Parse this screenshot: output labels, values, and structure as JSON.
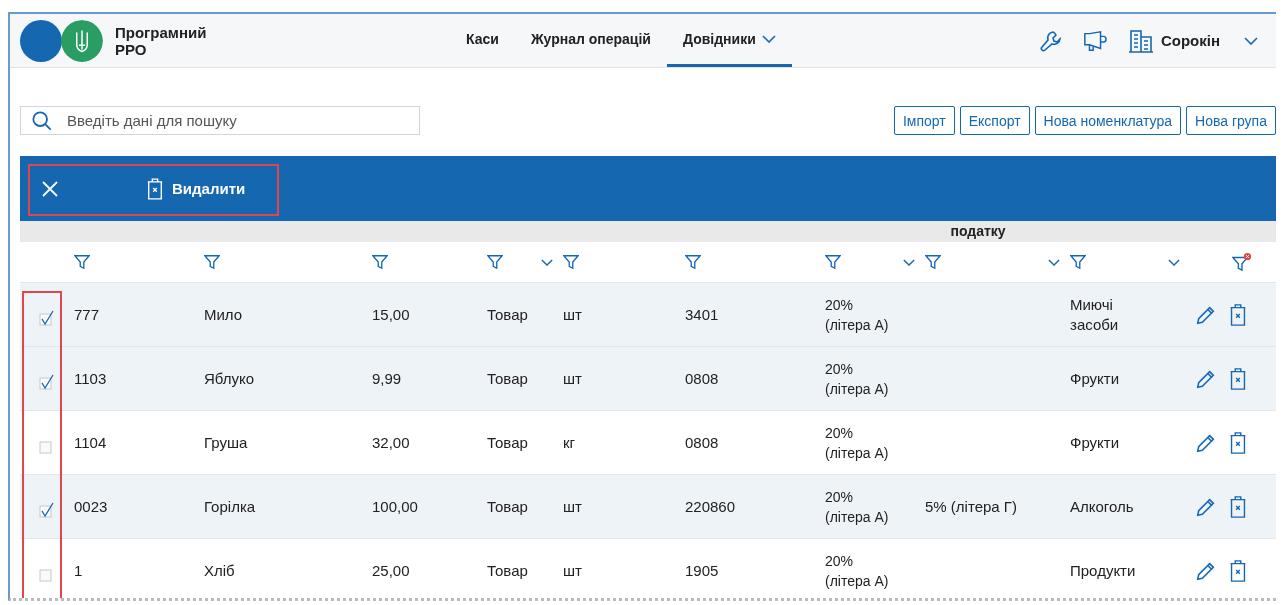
{
  "header": {
    "app_title": "Програмний РРО",
    "nav": [
      {
        "label": "Каси",
        "selected": false,
        "dropdown": false
      },
      {
        "label": "Журнал операцій",
        "selected": false,
        "dropdown": false
      },
      {
        "label": "Довідники",
        "selected": true,
        "dropdown": true
      }
    ],
    "user": "Сорокін"
  },
  "search": {
    "placeholder": "Введіть дані для пошуку"
  },
  "actions": [
    "Імпорт",
    "Експорт",
    "Нова номенклатура",
    "Нова група"
  ],
  "selection_bar": {
    "delete_label": "Видалити"
  },
  "header_fragment": "податку",
  "filters": [
    {
      "kind": "filter",
      "dropdown": false
    },
    {
      "kind": "filter",
      "dropdown": false
    },
    {
      "kind": "filter",
      "dropdown": false
    },
    {
      "kind": "filter",
      "dropdown": true
    },
    {
      "kind": "filter",
      "dropdown": false
    },
    {
      "kind": "filter",
      "dropdown": false
    },
    {
      "kind": "filter",
      "dropdown": true
    },
    {
      "kind": "filter",
      "dropdown": true
    },
    {
      "kind": "filter",
      "dropdown": true
    },
    {
      "kind": "filter-clear",
      "dropdown": false
    }
  ],
  "rows": [
    {
      "checked": true,
      "code": "777",
      "name": "Мило",
      "price": "15,00",
      "type": "Товар",
      "unit": "шт",
      "uktzed": "3401",
      "vat": "20% (літера А)",
      "excise": "",
      "group": "Миючі засоби"
    },
    {
      "checked": true,
      "code": "1103",
      "name": "Яблуко",
      "price": "9,99",
      "type": "Товар",
      "unit": "шт",
      "uktzed": "0808",
      "vat": "20% (літера А)",
      "excise": "",
      "group": "Фрукти"
    },
    {
      "checked": false,
      "code": "1104",
      "name": "Груша",
      "price": "32,00",
      "type": "Товар",
      "unit": "кг",
      "uktzed": "0808",
      "vat": "20% (літера А)",
      "excise": "",
      "group": "Фрукти"
    },
    {
      "checked": true,
      "code": "0023",
      "name": "Горілка",
      "price": "100,00",
      "type": "Товар",
      "unit": "шт",
      "uktzed": "220860",
      "vat": "20% (літера А)",
      "excise": "5% (літера Г)",
      "group": "Алкоголь"
    },
    {
      "checked": false,
      "code": "1",
      "name": "Хліб",
      "price": "25,00",
      "type": "Товар",
      "unit": "шт",
      "uktzed": "1905",
      "vat": "20% (літера А)",
      "excise": "",
      "group": "Продукти"
    }
  ]
}
